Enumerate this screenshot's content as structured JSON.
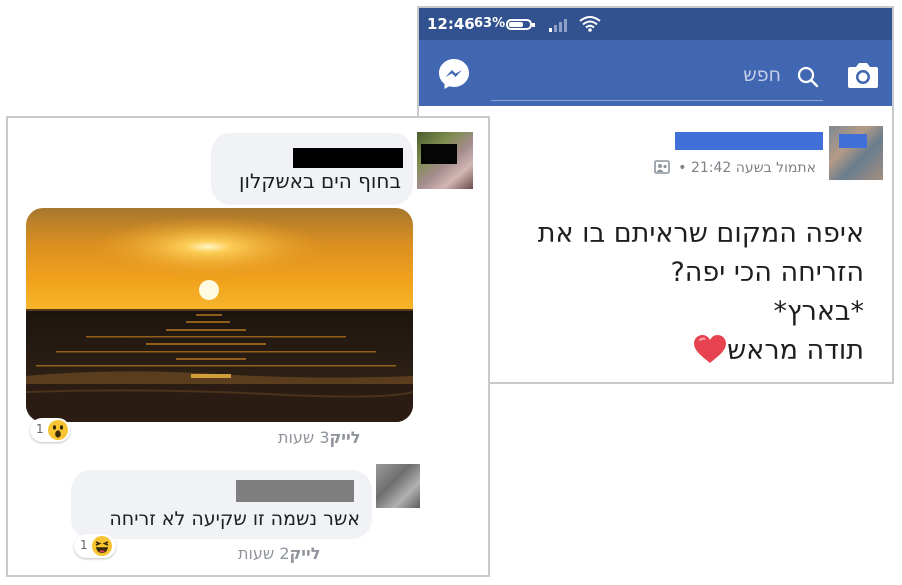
{
  "status_bar": {
    "time": "12:46",
    "battery": "63%"
  },
  "fb_bar": {
    "search_label": "חפש"
  },
  "post": {
    "meta": "אתמול בשעה 21:42 •",
    "lines": [
      "איפה המקום שראיתם בו את",
      "הזריחה הכי יפה?",
      "*בארץ*",
      "תודה מראש"
    ]
  },
  "comments": [
    {
      "text": "בחוף הים באשקלון",
      "reaction_count": "1",
      "time": "3 שעות",
      "like": "לייק",
      "reaction": "wow"
    },
    {
      "text": "אשר נשמה זו שקיעה לא זריחה",
      "reaction_count": "1",
      "time": "2 שעות",
      "like": "לייק",
      "reaction": "haha"
    }
  ],
  "colors": {
    "status_bar": "#32528f",
    "fb_blue": "#4267b2",
    "redaction_blue": "#3f6fd7",
    "bubble": "#f0f2f5"
  }
}
